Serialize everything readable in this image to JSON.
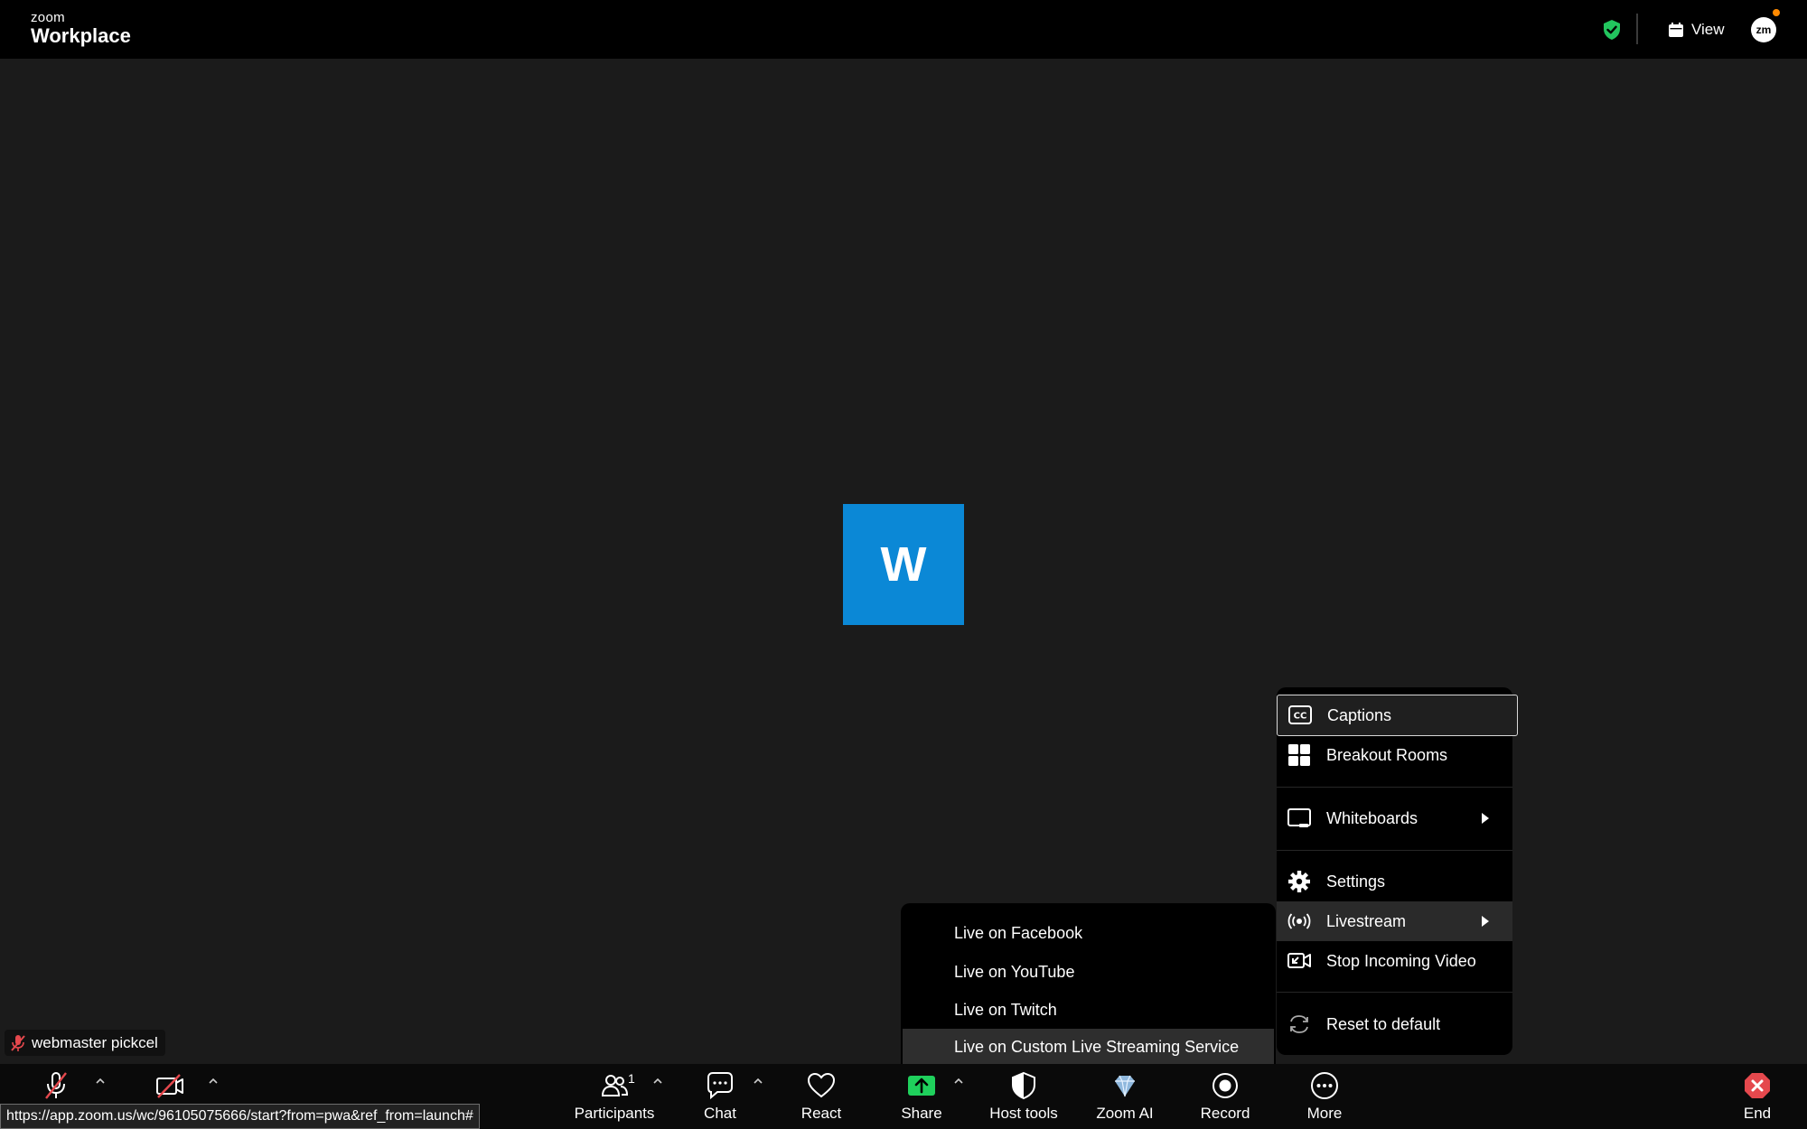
{
  "header": {
    "brand_small": "zoom",
    "brand_big": "Workplace",
    "view_label": "View",
    "avatar_initials": "zm"
  },
  "stage": {
    "participant_initial": "W",
    "participant_tile_color": "#0b88d6",
    "name_tag": "webmaster pickcel"
  },
  "more_menu": {
    "items": [
      {
        "label": "Captions",
        "icon": "cc-icon"
      },
      {
        "label": "Breakout Rooms",
        "icon": "grid-icon"
      },
      {
        "label": "Whiteboards",
        "icon": "whiteboard-icon",
        "submenu": true
      },
      {
        "label": "Settings",
        "icon": "gear-icon"
      },
      {
        "label": "Livestream",
        "icon": "broadcast-icon",
        "submenu": true,
        "active": true
      },
      {
        "label": "Stop Incoming Video",
        "icon": "video-off-icon"
      },
      {
        "label": "Reset to default",
        "icon": "reset-icon"
      }
    ]
  },
  "livestream_menu": {
    "items": [
      {
        "label": "Live on Facebook"
      },
      {
        "label": "Live on YouTube"
      },
      {
        "label": "Live on Twitch"
      },
      {
        "label": "Live on Custom Live Streaming Service",
        "active": true
      }
    ]
  },
  "toolbar": {
    "participants_label": "Participants",
    "participants_count": "1",
    "chat_label": "Chat",
    "react_label": "React",
    "share_label": "Share",
    "host_tools_label": "Host tools",
    "zoom_ai_label": "Zoom AI",
    "record_label": "Record",
    "more_label": "More",
    "end_label": "End"
  },
  "status_bar": {
    "url": "https://app.zoom.us/wc/96105075666/start?from=pwa&ref_from=launch#"
  },
  "colors": {
    "accent_green": "#22c55e",
    "share_green": "#1fd05c",
    "end_red": "#e5484d",
    "mute_red": "#e5484d"
  }
}
